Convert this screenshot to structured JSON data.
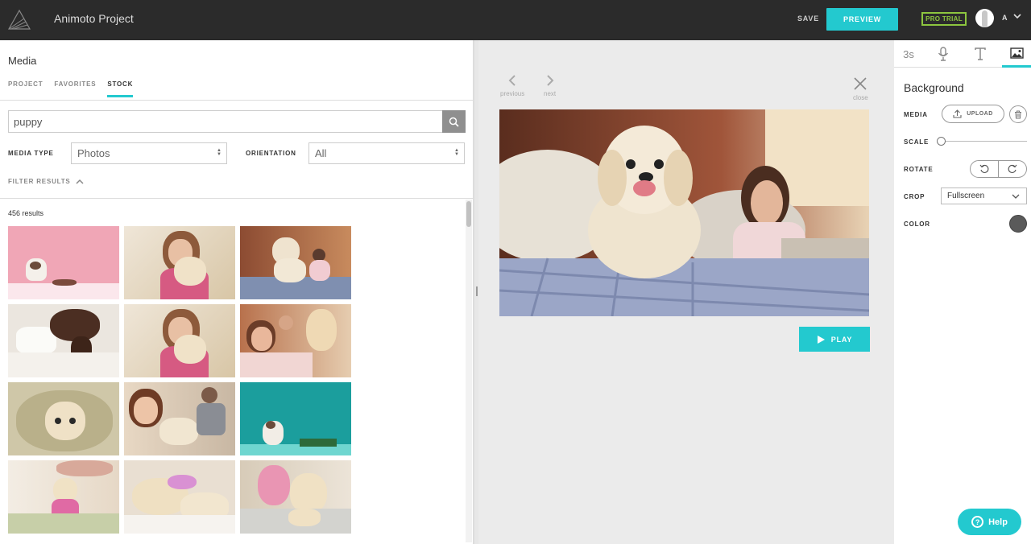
{
  "header": {
    "title": "Animoto Project",
    "save_label": "SAVE",
    "preview_label": "PREVIEW",
    "pro_badge": "PRO TRIAL",
    "user_initial": "A"
  },
  "media": {
    "title": "Media",
    "tabs": [
      {
        "label": "PROJECT",
        "active": false
      },
      {
        "label": "FAVORITES",
        "active": false
      },
      {
        "label": "STOCK",
        "active": true
      }
    ],
    "search": {
      "value": "puppy"
    },
    "media_type": {
      "label": "MEDIA TYPE",
      "value": "Photos"
    },
    "orientation": {
      "label": "ORIENTATION",
      "value": "All"
    },
    "filter_results_label": "FILTER RESULTS",
    "results_count": "456 results"
  },
  "preview": {
    "previous_label": "previous",
    "next_label": "next",
    "close_label": "close",
    "play_label": "PLAY"
  },
  "settings": {
    "tabs": [
      {
        "label": "3s",
        "icon": "duration"
      },
      {
        "label": "",
        "icon": "microphone-icon"
      },
      {
        "label": "",
        "icon": "text-icon"
      },
      {
        "label": "",
        "icon": "image-icon",
        "active": true
      }
    ],
    "title": "Background",
    "media_label": "MEDIA",
    "upload_label": "UPLOAD",
    "scale_label": "SCALE",
    "scale_value": 0,
    "rotate_label": "ROTATE",
    "crop_label": "CROP",
    "crop_value": "Fullscreen",
    "color_label": "COLOR",
    "color_value": "#5a5a5a"
  },
  "help_label": "Help",
  "colors": {
    "accent": "#23c9cf",
    "topbar": "#2b2b2b",
    "pro": "#8dc63f"
  }
}
